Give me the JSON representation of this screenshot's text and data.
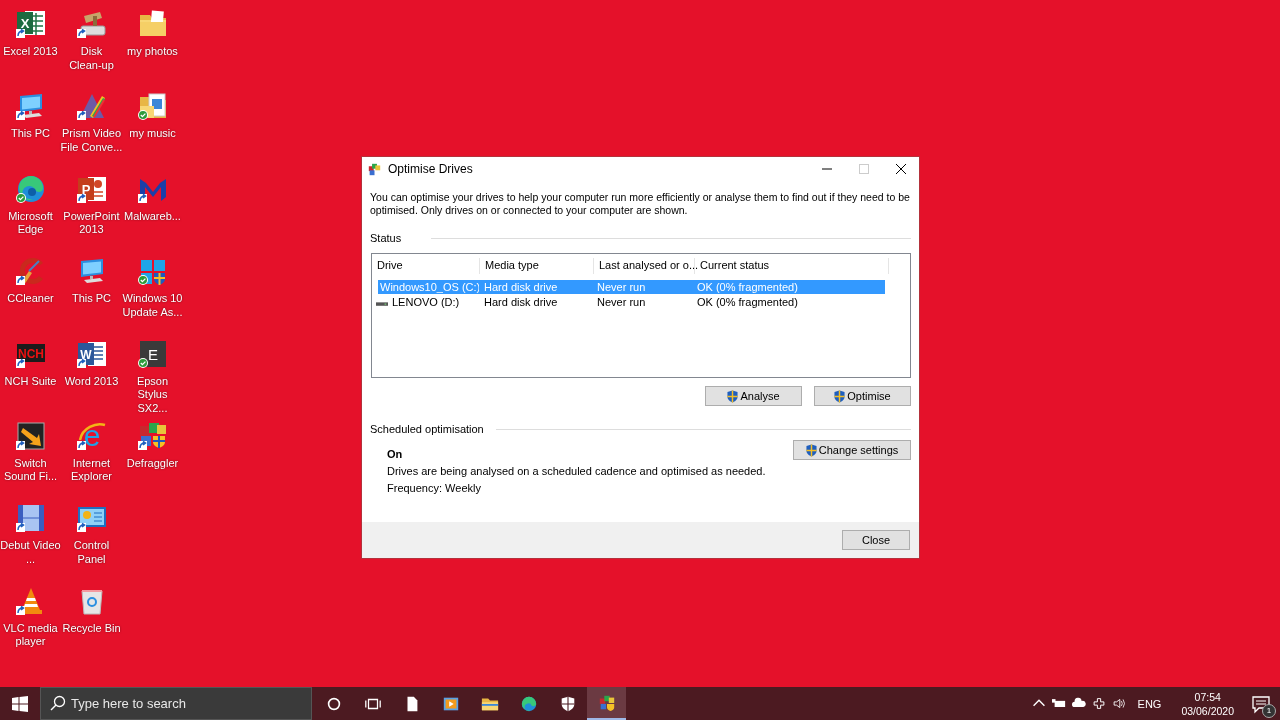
{
  "desktop_icons": [
    {
      "label": "Excel 2013",
      "kind": "spreadsheet",
      "glyph": "X",
      "shortcut": true,
      "synced": false
    },
    {
      "label": "This PC",
      "kind": "computer",
      "shortcut": true,
      "synced": false
    },
    {
      "label": "Microsoft Edge",
      "kind": "swirl",
      "shortcut": false,
      "synced": true
    },
    {
      "label": "CCleaner",
      "kind": "broom",
      "shortcut": true,
      "synced": false
    },
    {
      "label": "NCH Suite",
      "kind": "nch",
      "glyph": "NCH",
      "shortcut": true,
      "synced": false
    },
    {
      "label": "Switch Sound Fi...",
      "kind": "switch",
      "shortcut": true,
      "synced": false
    },
    {
      "label": "Debut Video ...",
      "kind": "film",
      "shortcut": true,
      "synced": false
    },
    {
      "label": "VLC media player",
      "kind": "cone",
      "shortcut": true,
      "synced": false
    },
    {
      "label": "Disk Clean-up",
      "kind": "cleanup",
      "shortcut": true,
      "synced": false
    },
    {
      "label": "Prism Video File Conve...",
      "kind": "prism",
      "shortcut": true,
      "synced": false
    },
    {
      "label": "PowerPoint 2013",
      "kind": "slides",
      "glyph": "P",
      "shortcut": true,
      "synced": false
    },
    {
      "label": "This PC",
      "kind": "computer",
      "shortcut": false,
      "synced": false
    },
    {
      "label": "Word 2013",
      "kind": "document",
      "glyph": "W",
      "shortcut": true,
      "synced": false
    },
    {
      "label": "Internet Explorer",
      "kind": "globe",
      "glyph": "e",
      "shortcut": true,
      "synced": false
    },
    {
      "label": "Control Panel",
      "kind": "panel",
      "shortcut": true,
      "synced": false
    },
    {
      "label": "Recycle Bin",
      "kind": "bin",
      "shortcut": false,
      "synced": false
    },
    {
      "label": "my photos",
      "kind": "folder",
      "shortcut": false,
      "synced": false
    },
    {
      "label": "my music",
      "kind": "folder-file",
      "shortcut": false,
      "synced": true
    },
    {
      "label": "Malwareb...",
      "kind": "m-logo",
      "shortcut": true,
      "synced": false
    },
    {
      "label": "Windows 10 Update As...",
      "kind": "update",
      "shortcut": false,
      "synced": true
    },
    {
      "label": "Epson Stylus SX2...",
      "kind": "tile",
      "glyph": "E",
      "shortcut": false,
      "synced": true
    },
    {
      "label": "Defraggler",
      "kind": "blocks",
      "shortcut": true,
      "synced": false
    }
  ],
  "dialog": {
    "title": "Optimise Drives",
    "maximize_disabled": true,
    "description": "You can optimise your drives to help your computer run more efficiently or analyse them to find out if they need to be optimised. Only drives on or connected to your computer are shown.",
    "status_label": "Status",
    "table": {
      "columns": [
        "Drive",
        "Media type",
        "Last analysed or o...",
        "Current status"
      ],
      "rows": [
        {
          "kind": "system",
          "drive": "Windows10_OS (C:)",
          "media_type": "Hard disk drive",
          "last_run": "Never run",
          "status": "OK (0% fragmented)",
          "selected": true
        },
        {
          "kind": "disk",
          "drive": "LENOVO (D:)",
          "media_type": "Hard disk drive",
          "last_run": "Never run",
          "status": "OK (0% fragmented)",
          "selected": false
        }
      ]
    },
    "actions": [
      "Analyse",
      "Optimise"
    ],
    "schedule": {
      "label": "Scheduled optimisation",
      "state": "On",
      "description": "Drives are being analysed on a scheduled cadence and optimised as needed.",
      "frequency": "Frequency: Weekly",
      "button": "Change settings"
    },
    "close_button": "Close"
  },
  "taskbar": {
    "search_placeholder": "Type here to search",
    "apps": [
      {
        "kind": "circle",
        "active": false
      },
      {
        "kind": "task-view",
        "active": false
      },
      {
        "kind": "page",
        "active": false
      },
      {
        "kind": "player",
        "active": false
      },
      {
        "kind": "folder",
        "active": false
      },
      {
        "kind": "swirl",
        "active": false
      },
      {
        "kind": "shield",
        "active": false
      },
      {
        "kind": "blocks",
        "active": true
      }
    ],
    "language": "ENG",
    "time": "07:54",
    "date": "03/06/2020",
    "notification_count": "1"
  }
}
